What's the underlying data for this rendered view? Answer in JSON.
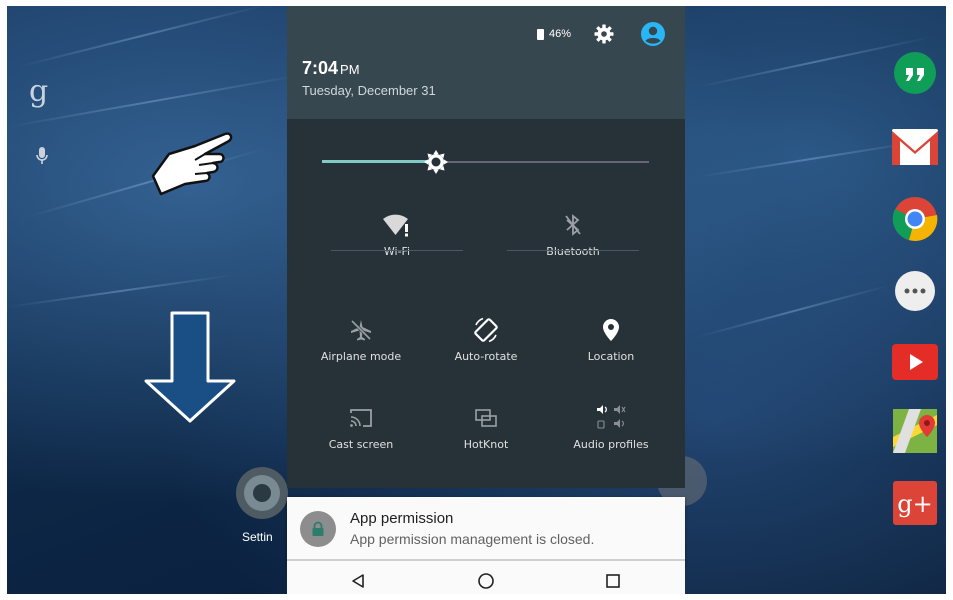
{
  "status": {
    "time": "7:04",
    "ampm": "PM",
    "date": "Tuesday, December 31",
    "battery": "46%"
  },
  "icons": {
    "settings": "gear-icon",
    "account": "user-icon",
    "brightness": "brightness-icon"
  },
  "brightness": {
    "level": 0.35
  },
  "quick_settings": {
    "wifi": "Wi-Fi",
    "bluetooth": "Bluetooth",
    "airplane": "Airplane mode",
    "autorotate": "Auto-rotate",
    "location": "Location",
    "cast": "Cast screen",
    "hotknot": "HotKnot",
    "audio": "Audio profiles"
  },
  "home": {
    "settings_label": "Settin"
  },
  "notification": {
    "title": "App permission",
    "text": "App permission management is closed."
  },
  "colors": {
    "accent": "#80cbc4",
    "shade": "#263238",
    "shade_header": "#37474f"
  }
}
